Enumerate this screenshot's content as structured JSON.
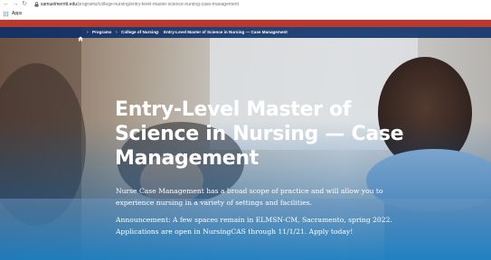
{
  "browser": {
    "url_domain": "samuelmerritt.edu",
    "url_path": "/programs/college-nursing/entry-level-master-science-nursing-case-management",
    "bookmarks": {
      "apps_label": "Apps"
    }
  },
  "breadcrumb": {
    "home_icon": "home-icon",
    "items": [
      "Programs",
      "College of Nursing",
      "Entry-Level Master of Science in Nursing — Case Management"
    ]
  },
  "hero": {
    "title": "Entry-Level Master of Science in Nursing — Case Management",
    "description": "Nurse Case Management has a broad scope of practice and will allow you to experience nursing in a variety of settings and facilities.",
    "announcement": "Announcement: A few spaces remain in ELMSN-CM, Sacramento, spring 2022.  Applications are open in NursingCAS through 11/1/21.  Apply today!"
  },
  "colors": {
    "brand_red": "#b83a2e",
    "breadcrumb_bg": "#0a2d69",
    "hero_blue": "#1278be"
  }
}
